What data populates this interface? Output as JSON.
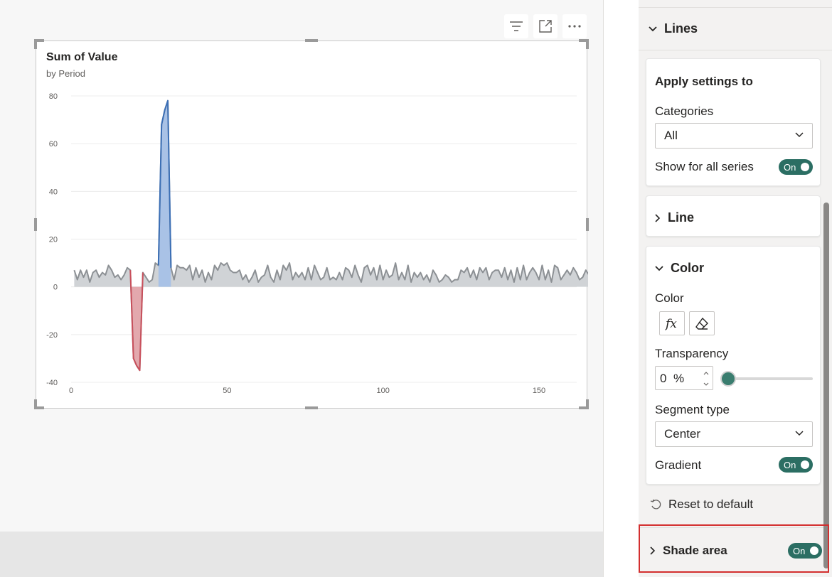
{
  "visual_header": {
    "icons": [
      "filter-icon",
      "focus-mode-icon",
      "more-options-icon"
    ]
  },
  "chart_data": {
    "type": "area",
    "title": "Sum of Value",
    "subtitle": "by Period",
    "xlabel": "",
    "ylabel": "",
    "xlim": [
      0,
      150
    ],
    "ylim": [
      -40,
      80
    ],
    "x_ticks": [
      "0",
      "50",
      "100",
      "150"
    ],
    "y_ticks": [
      "80",
      "60",
      "40",
      "20",
      "0",
      "-20",
      "-40"
    ],
    "grid": true,
    "colors": {
      "line": "#8c9094",
      "fill": "#d0d3d6",
      "positive_line": "#3b6fb6",
      "positive_fill": "#a9c2e6",
      "negative_line": "#c94f5b",
      "negative_fill": "#e3a8ad"
    },
    "series": [
      {
        "x": [
          1,
          2,
          3,
          4,
          5,
          6,
          7,
          8,
          9,
          10,
          11,
          12,
          13,
          14,
          15,
          16,
          17,
          18,
          19,
          20,
          21,
          22,
          23,
          24,
          25,
          26,
          27,
          28,
          29,
          30,
          31,
          32,
          33,
          34,
          35,
          36,
          37,
          38,
          39,
          40,
          41,
          42,
          43,
          44,
          45,
          46,
          47,
          48,
          49,
          50,
          51,
          52,
          53,
          54,
          55,
          56,
          57,
          58,
          59,
          60,
          61,
          62,
          63,
          64,
          65,
          66,
          67,
          68,
          69,
          70,
          71,
          72,
          73,
          74,
          75,
          76,
          77,
          78,
          79,
          80,
          81,
          82,
          83,
          84,
          85,
          86,
          87,
          88,
          89,
          90,
          91,
          92,
          93,
          94,
          95,
          96,
          97,
          98,
          99,
          100,
          101,
          102,
          103,
          104,
          105,
          106,
          107,
          108,
          109,
          110,
          111,
          112,
          113,
          114,
          115,
          116,
          117,
          118,
          119,
          120,
          121,
          122,
          123,
          124,
          125,
          126,
          127,
          128,
          129,
          130,
          131,
          132,
          133,
          134,
          135,
          136,
          137,
          138,
          139,
          140,
          141,
          142,
          143,
          144,
          145,
          146,
          147,
          148,
          149,
          150,
          151,
          152,
          153,
          154,
          155,
          156,
          157,
          158,
          159,
          160,
          161,
          162,
          163,
          164,
          165,
          166,
          167,
          168,
          169,
          170,
          171,
          172,
          173,
          174
        ],
        "values": [
          7,
          3,
          7,
          4,
          7,
          2,
          6,
          7,
          4,
          6,
          5,
          9,
          7,
          4,
          5,
          3,
          5,
          8,
          7,
          -30,
          -33,
          -35,
          6,
          4,
          2,
          3,
          10,
          9,
          68,
          74,
          78,
          8,
          3,
          9,
          8,
          8,
          7,
          9,
          3,
          8,
          4,
          7,
          2,
          6,
          3,
          9,
          7,
          10,
          9,
          10,
          7,
          6,
          6,
          7,
          3,
          5,
          2,
          4,
          7,
          2,
          4,
          5,
          9,
          4,
          2,
          7,
          3,
          9,
          7,
          10,
          3,
          6,
          4,
          6,
          3,
          8,
          3,
          9,
          6,
          3,
          4,
          8,
          3,
          4,
          3,
          6,
          3,
          8,
          7,
          4,
          9,
          5,
          2,
          8,
          9,
          5,
          8,
          3,
          9,
          3,
          7,
          4,
          5,
          10,
          3,
          6,
          3,
          9,
          2,
          6,
          4,
          6,
          3,
          5,
          2,
          7,
          5,
          2,
          3,
          5,
          4,
          2,
          3,
          3,
          7,
          6,
          8,
          4,
          7,
          3,
          8,
          6,
          8,
          3,
          6,
          7,
          7,
          4,
          8,
          3,
          7,
          2,
          8,
          3,
          9,
          3,
          6,
          8,
          6,
          3,
          9,
          3,
          7,
          2,
          9,
          8,
          3,
          5,
          7,
          5,
          8,
          6,
          3,
          4,
          7,
          5,
          3,
          2,
          9,
          4,
          7,
          3,
          6,
          4
        ]
      }
    ]
  },
  "pane": {
    "section_title": "Lines",
    "apply_settings": {
      "title": "Apply settings to",
      "categories_label": "Categories",
      "categories_value": "All",
      "show_all_label": "Show for all series",
      "show_all_toggle": "On"
    },
    "line_section": {
      "title": "Line"
    },
    "color_section": {
      "title": "Color",
      "color_label": "Color",
      "transparency_label": "Transparency",
      "transparency_value": "0",
      "transparency_unit": "%",
      "transparency_level": 0,
      "segment_label": "Segment type",
      "segment_value": "Center",
      "gradient_label": "Gradient",
      "gradient_toggle": "On"
    },
    "reset_label": "Reset to default",
    "shade_area": {
      "label": "Shade area",
      "toggle": "On"
    }
  }
}
